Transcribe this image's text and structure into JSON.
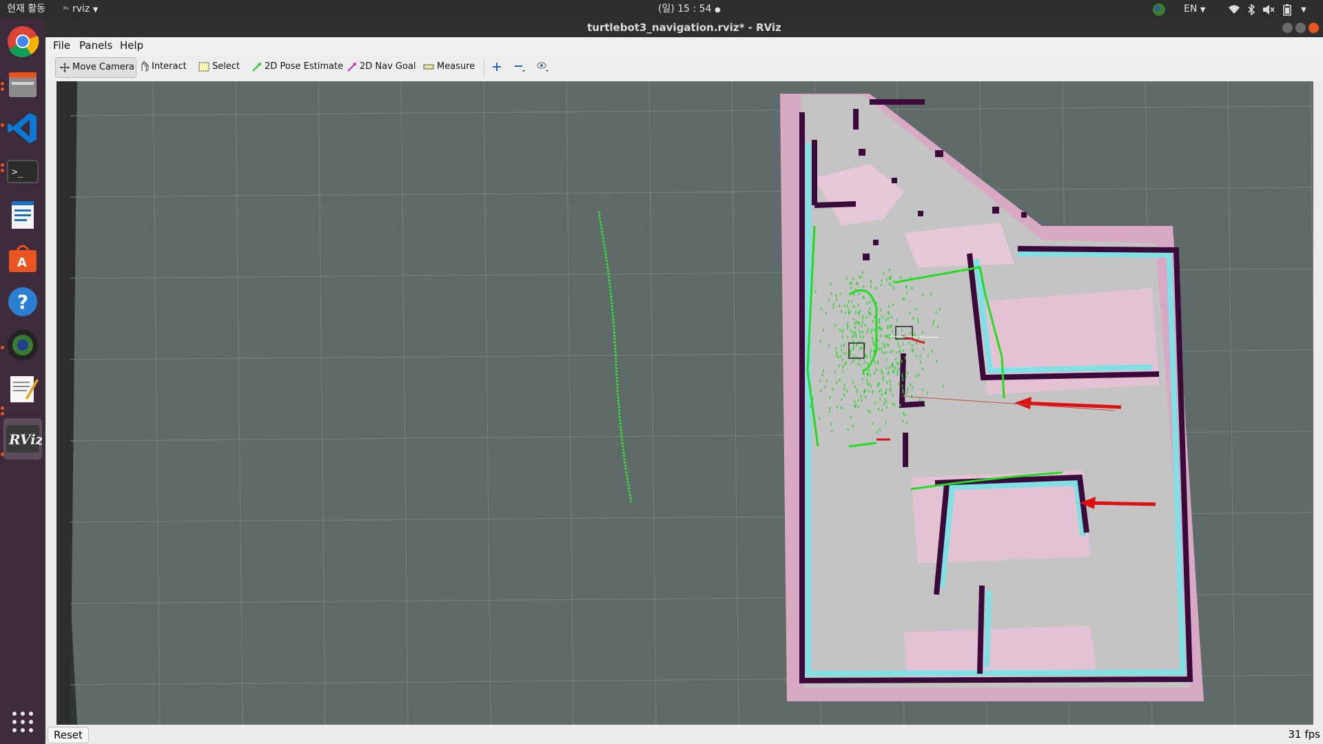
{
  "topbar": {
    "activities": "현재 활동",
    "app_menu": "rviz",
    "clock": "(일) 15 : 54",
    "lang": "EN"
  },
  "dock": {
    "apps": [
      "chrome-icon",
      "files-icon",
      "vscode-icon",
      "terminal-icon",
      "writer-icon",
      "software-icon",
      "help-icon",
      "camera-icon",
      "text-editor-icon",
      "rviz-icon"
    ],
    "show_apps": "apps-grid-icon"
  },
  "window": {
    "title": "turtlebot3_navigation.rviz* - RViz",
    "menu": {
      "file": "File",
      "panels": "Panels",
      "help": "Help"
    },
    "toolbar": {
      "move_camera": "Move Camera",
      "interact": "Interact",
      "select": "Select",
      "pose_estimate": "2D Pose Estimate",
      "nav_goal": "2D Nav Goal",
      "measure": "Measure"
    },
    "status": {
      "reset": "Reset",
      "fps": "31 fps"
    }
  },
  "colors": {
    "grid_bg": "#5f6b69",
    "grid_line": "#7c8785",
    "map_free": "#c0c0c0",
    "map_wall": "#3a0a3a",
    "costmap_pink": "#d9a3bf",
    "inflation_cyan": "#7fe0e6",
    "path_green": "#22dd22",
    "arrow_red": "#dd1111"
  }
}
